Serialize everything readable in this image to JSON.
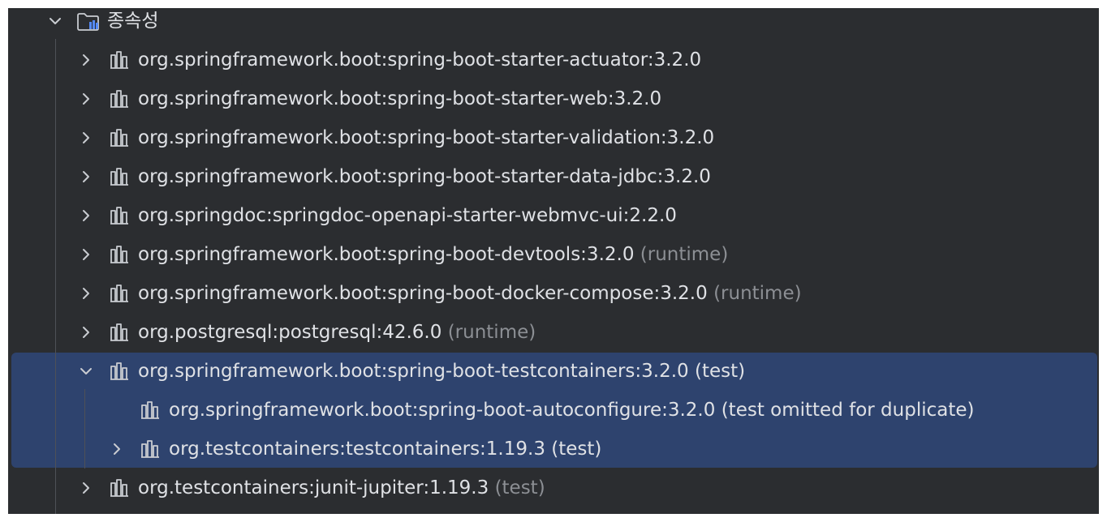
{
  "root": {
    "label": "종속성",
    "icon": "folder-library-icon",
    "expanded": true
  },
  "dependencies": [
    {
      "coordinate": "org.springframework.boot:spring-boot-starter-actuator:3.2.0",
      "scope": ""
    },
    {
      "coordinate": "org.springframework.boot:spring-boot-starter-web:3.2.0",
      "scope": ""
    },
    {
      "coordinate": "org.springframework.boot:spring-boot-starter-validation:3.2.0",
      "scope": ""
    },
    {
      "coordinate": "org.springframework.boot:spring-boot-starter-data-jdbc:3.2.0",
      "scope": ""
    },
    {
      "coordinate": "org.springdoc:springdoc-openapi-starter-webmvc-ui:2.2.0",
      "scope": ""
    },
    {
      "coordinate": "org.springframework.boot:spring-boot-devtools:3.2.0",
      "scope": "(runtime)"
    },
    {
      "coordinate": "org.springframework.boot:spring-boot-docker-compose:3.2.0",
      "scope": "(runtime)"
    },
    {
      "coordinate": "org.postgresql:postgresql:42.6.0",
      "scope": "(runtime)"
    },
    {
      "coordinate": "org.springframework.boot:spring-boot-testcontainers:3.2.0",
      "scope": "(test)",
      "expanded": true,
      "selected": true,
      "children": [
        {
          "coordinate": "org.springframework.boot:spring-boot-autoconfigure:3.2.0",
          "scope": "(test omitted for duplicate)"
        },
        {
          "coordinate": "org.testcontainers:testcontainers:1.19.3",
          "scope": "(test)"
        }
      ]
    },
    {
      "coordinate": "org.testcontainers:junit-jupiter:1.19.3",
      "scope": "(test)"
    }
  ],
  "colors": {
    "panel_background": "#2b2d30",
    "selection_background": "#2e436e",
    "text": "#dfe1e5",
    "dim_text": "#8c8f94",
    "guide_line": "#4e5157"
  }
}
